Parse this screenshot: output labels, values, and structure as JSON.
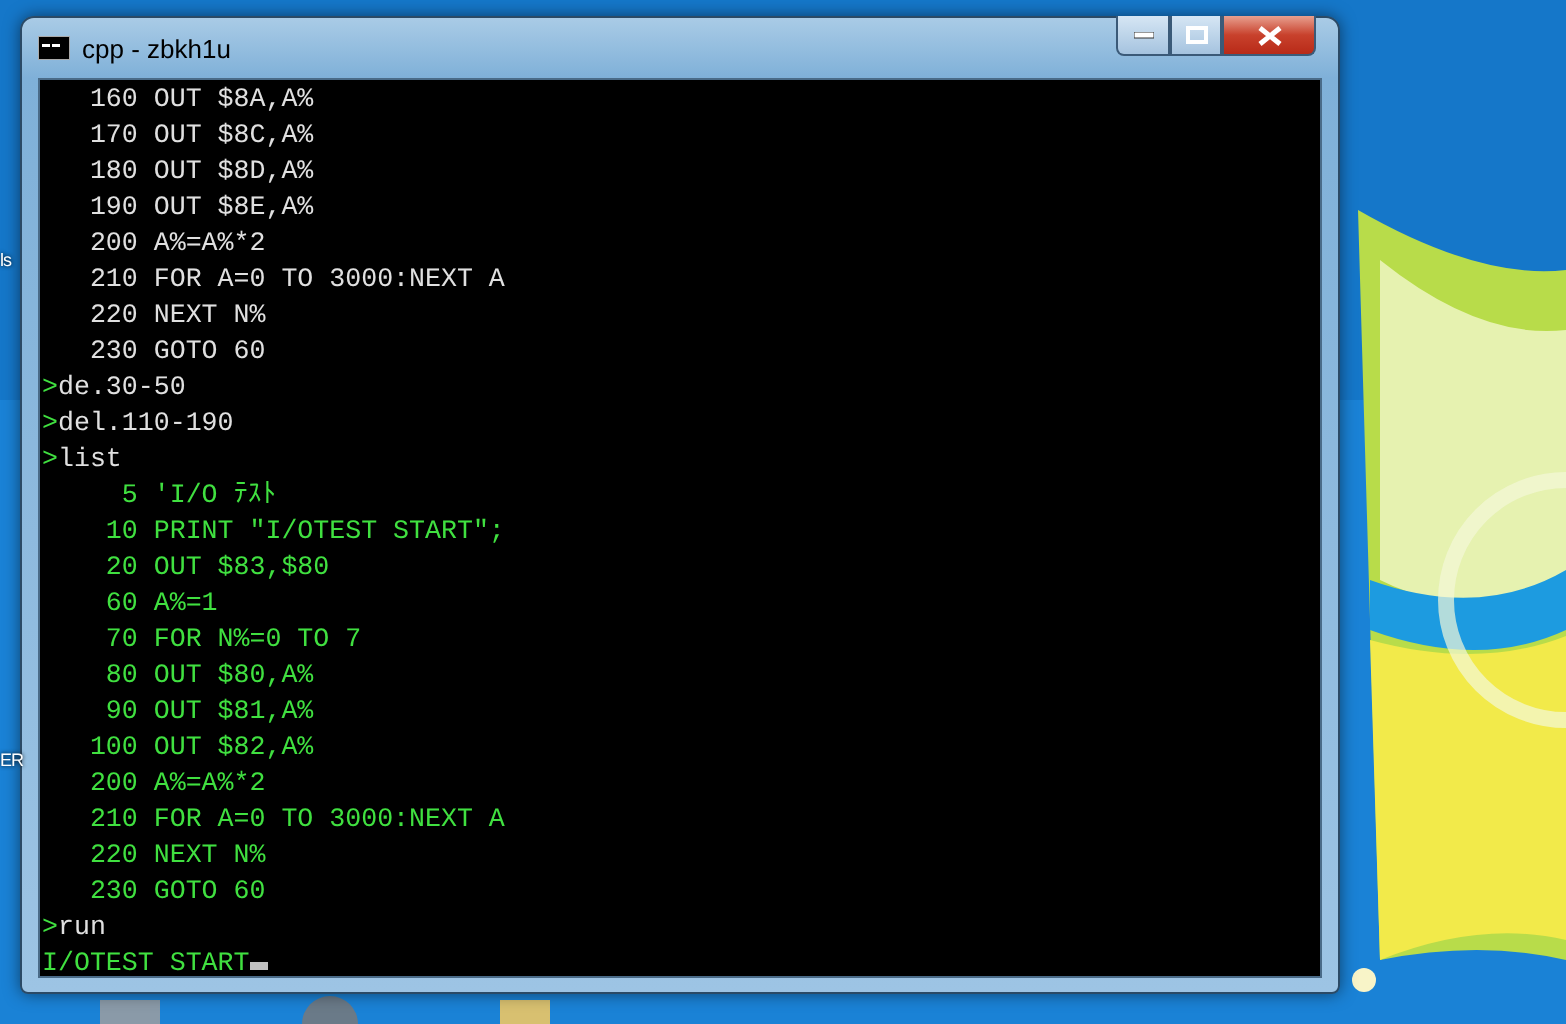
{
  "desktop": {
    "icon_labels": [
      "ls",
      "ER"
    ]
  },
  "window": {
    "title": "cpp - zbkh1u"
  },
  "console": {
    "lines": [
      {
        "kind": "text",
        "color": "#e0e0e0",
        "text": "   160 OUT $8A,A%"
      },
      {
        "kind": "text",
        "color": "#e0e0e0",
        "text": "   170 OUT $8C,A%"
      },
      {
        "kind": "text",
        "color": "#e0e0e0",
        "text": "   180 OUT $8D,A%"
      },
      {
        "kind": "text",
        "color": "#e0e0e0",
        "text": "   190 OUT $8E,A%"
      },
      {
        "kind": "text",
        "color": "#e0e0e0",
        "text": "   200 A%=A%*2"
      },
      {
        "kind": "text",
        "color": "#e0e0e0",
        "text": "   210 FOR A=0 TO 3000:NEXT A"
      },
      {
        "kind": "text",
        "color": "#e0e0e0",
        "text": "   220 NEXT N%"
      },
      {
        "kind": "text",
        "color": "#e0e0e0",
        "text": "   230 GOTO 60"
      },
      {
        "kind": "prompt",
        "prompt": ">",
        "color": "#e0e0e0",
        "text": "de.30-50"
      },
      {
        "kind": "prompt",
        "prompt": ">",
        "color": "#e0e0e0",
        "text": "del.110-190"
      },
      {
        "kind": "prompt",
        "prompt": ">",
        "color": "#e0e0e0",
        "text": "list"
      },
      {
        "kind": "text",
        "color": "#40e040",
        "text": "     5 'I/O ﾃｽﾄ"
      },
      {
        "kind": "text",
        "color": "#40e040",
        "text": "    10 PRINT \"I/OTEST START\";"
      },
      {
        "kind": "text",
        "color": "#40e040",
        "text": "    20 OUT $83,$80"
      },
      {
        "kind": "text",
        "color": "#40e040",
        "text": "    60 A%=1"
      },
      {
        "kind": "text",
        "color": "#40e040",
        "text": "    70 FOR N%=0 TO 7"
      },
      {
        "kind": "text",
        "color": "#40e040",
        "text": "    80 OUT $80,A%"
      },
      {
        "kind": "text",
        "color": "#40e040",
        "text": "    90 OUT $81,A%"
      },
      {
        "kind": "text",
        "color": "#40e040",
        "text": "   100 OUT $82,A%"
      },
      {
        "kind": "text",
        "color": "#40e040",
        "text": "   200 A%=A%*2"
      },
      {
        "kind": "text",
        "color": "#40e040",
        "text": "   210 FOR A=0 TO 3000:NEXT A"
      },
      {
        "kind": "text",
        "color": "#40e040",
        "text": "   220 NEXT N%"
      },
      {
        "kind": "text",
        "color": "#40e040",
        "text": "   230 GOTO 60"
      },
      {
        "kind": "prompt",
        "prompt": ">",
        "color": "#e0e0e0",
        "text": "run"
      },
      {
        "kind": "output",
        "color": "#40e040",
        "text": "I/OTEST START",
        "cursor": true
      }
    ]
  }
}
